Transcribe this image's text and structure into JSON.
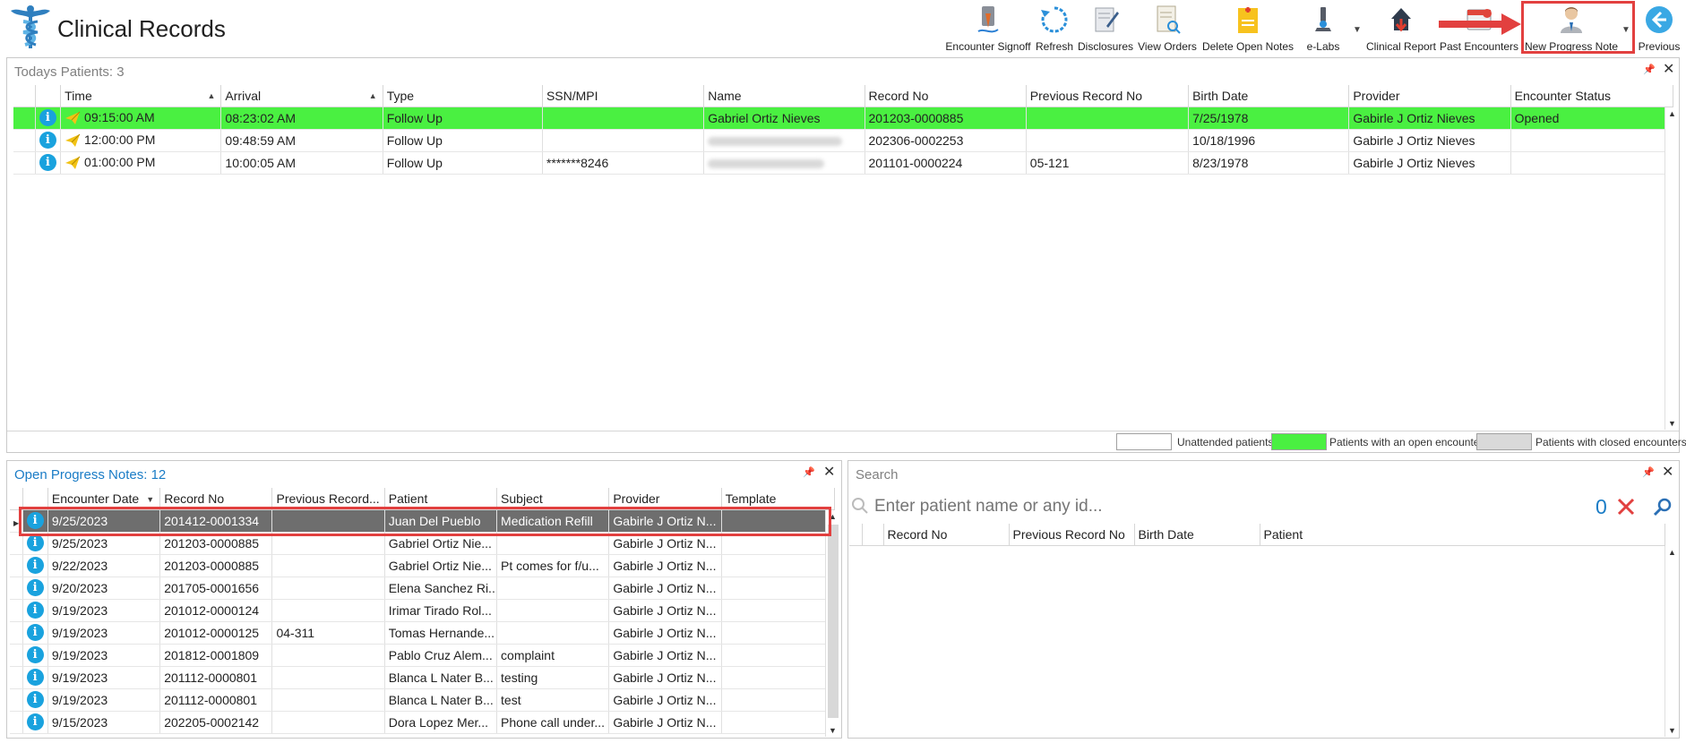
{
  "app": {
    "title": "Clinical Records"
  },
  "toolbar": {
    "buttons": [
      {
        "label": "Encounter Signoff",
        "icon": "signoff-icon"
      },
      {
        "label": "Refresh",
        "icon": "refresh-icon"
      },
      {
        "label": "Disclosures",
        "icon": "disclosures-icon"
      },
      {
        "label": "View Orders",
        "icon": "view-orders-icon"
      },
      {
        "label": "Delete Open Notes",
        "icon": "delete-notes-icon"
      },
      {
        "label": "e-Labs",
        "icon": "microscope-icon"
      },
      {
        "label": "Clinical Report",
        "icon": "clinical-report-icon"
      },
      {
        "label": "Past Encounters",
        "icon": "past-encounters-icon"
      },
      {
        "label": "New Progress Note",
        "icon": "new-progress-note-icon"
      },
      {
        "label": "Previous",
        "icon": "previous-arrow-icon"
      }
    ]
  },
  "todays": {
    "title": "Todays Patients:",
    "count": "3",
    "columns": [
      "Time",
      "Arrival",
      "Type",
      "SSN/MPI",
      "Name",
      "Record No",
      "Previous Record No",
      "Birth Date",
      "Provider",
      "Encounter Status"
    ],
    "rows": [
      {
        "time": "09:15:00 AM",
        "arrival": "08:23:02 AM",
        "type": "Follow Up",
        "ssn": "",
        "name": "Gabriel Ortiz Nieves",
        "record": "201203-0000885",
        "prev": "",
        "birth": "7/25/1978",
        "provider": "Gabirle J Ortiz Nieves",
        "status": "Opened"
      },
      {
        "time": "12:00:00 PM",
        "arrival": "09:48:59 AM",
        "type": "Follow Up",
        "ssn": "",
        "name": "",
        "record": "202306-0002253",
        "prev": "",
        "birth": "10/18/1996",
        "provider": "Gabirle J Ortiz Nieves",
        "status": ""
      },
      {
        "time": "01:00:00 PM",
        "arrival": "10:00:05 AM",
        "type": "Follow Up",
        "ssn": "*******8246",
        "name": "",
        "record": "201101-0000224",
        "prev": "05-121",
        "birth": "8/23/1978",
        "provider": "Gabirle J Ortiz Nieves",
        "status": ""
      }
    ]
  },
  "legend": {
    "unattended": "Unattended patients",
    "open": "Patients with an open encounter",
    "closed": "Patients with closed encounters",
    "colors": {
      "unattended": "#ffffff",
      "open": "#4af041",
      "closed": "#d9d9d9"
    }
  },
  "open_notes": {
    "title": "Open Progress Notes:",
    "count": "12",
    "columns": [
      "Encounter Date",
      "Record No",
      "Previous Record...",
      "Patient",
      "Subject",
      "Provider",
      "Template"
    ],
    "rows": [
      {
        "date": "9/25/2023",
        "record": "201412-0001334",
        "prev": "",
        "patient": "Juan Del Pueblo",
        "subject": "Medication Refill",
        "provider": "Gabirle J Ortiz N...",
        "template": ""
      },
      {
        "date": "9/25/2023",
        "record": "201203-0000885",
        "prev": "",
        "patient": "Gabriel Ortiz Nie...",
        "subject": "",
        "provider": "Gabirle J Ortiz N...",
        "template": ""
      },
      {
        "date": "9/22/2023",
        "record": "201203-0000885",
        "prev": "",
        "patient": "Gabriel Ortiz Nie...",
        "subject": "Pt comes for f/u...",
        "provider": "Gabirle J Ortiz N...",
        "template": ""
      },
      {
        "date": "9/20/2023",
        "record": "201705-0001656",
        "prev": "",
        "patient": "Elena Sanchez Ri...",
        "subject": "",
        "provider": "Gabirle J Ortiz N...",
        "template": ""
      },
      {
        "date": "9/19/2023",
        "record": "201012-0000124",
        "prev": "",
        "patient": "Irimar Tirado Rol...",
        "subject": "",
        "provider": "Gabirle J Ortiz N...",
        "template": ""
      },
      {
        "date": "9/19/2023",
        "record": "201012-0000125",
        "prev": "04-311",
        "patient": "Tomas Hernande...",
        "subject": "",
        "provider": "Gabirle J Ortiz N...",
        "template": ""
      },
      {
        "date": "9/19/2023",
        "record": "201812-0001809",
        "prev": "",
        "patient": "Pablo Cruz Alem...",
        "subject": "complaint",
        "provider": "Gabirle J Ortiz N...",
        "template": ""
      },
      {
        "date": "9/19/2023",
        "record": "201112-0000801",
        "prev": "",
        "patient": "Blanca L Nater B...",
        "subject": "testing",
        "provider": "Gabirle J Ortiz N...",
        "template": ""
      },
      {
        "date": "9/19/2023",
        "record": "201112-0000801",
        "prev": "",
        "patient": "Blanca L Nater B...",
        "subject": "test",
        "provider": "Gabirle J Ortiz N...",
        "template": ""
      },
      {
        "date": "9/15/2023",
        "record": "202205-0002142",
        "prev": "",
        "patient": "Dora Lopez Mer...",
        "subject": "Phone call under...",
        "provider": "Gabirle J Ortiz N...",
        "template": ""
      }
    ]
  },
  "search": {
    "title": "Search",
    "placeholder": "Enter patient name or any id...",
    "count": "0",
    "columns": [
      "Record No",
      "Previous Record No",
      "Birth Date",
      "Patient"
    ]
  },
  "colors": {
    "accent": "#1a7cc6",
    "highlight": "#e2403f",
    "open_encounter": "#4af041",
    "selected_row": "#6e6e6e"
  }
}
